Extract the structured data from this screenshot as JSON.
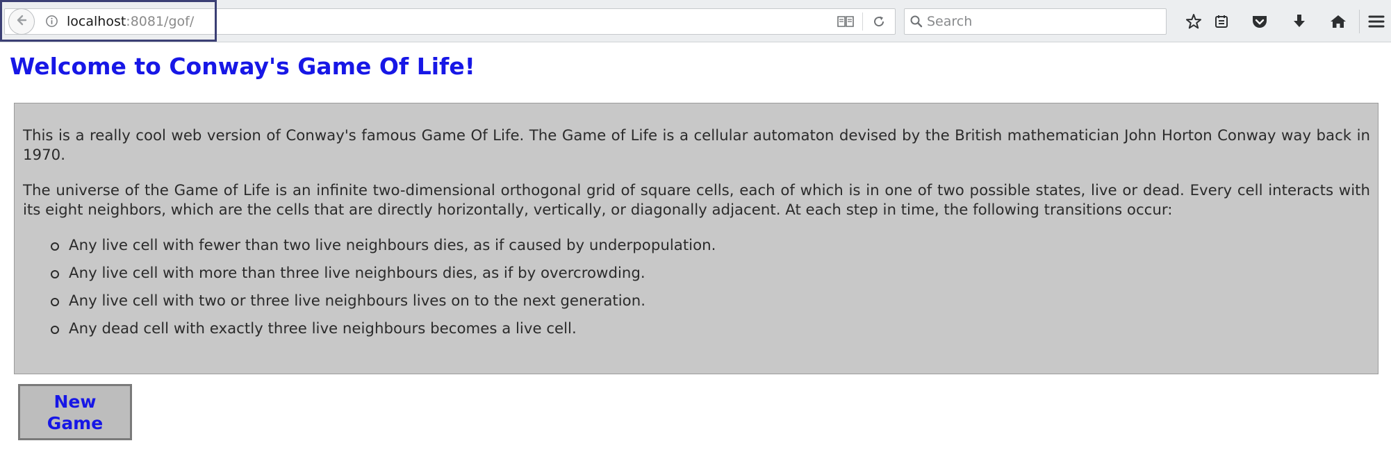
{
  "browser": {
    "url_host": "localhost",
    "url_rest": ":8081/gof/",
    "search_placeholder": "Search",
    "icons": {
      "back": "back-arrow-icon",
      "info": "info-icon",
      "reader": "reader-view-icon",
      "reload": "reload-icon",
      "search": "search-icon",
      "bookmark": "star-icon",
      "library": "library-icon",
      "pocket": "pocket-icon",
      "download": "download-icon",
      "home": "home-icon",
      "menu": "hamburger-menu-icon"
    }
  },
  "page": {
    "title": "Welcome to Conway's Game Of Life!",
    "intro": {
      "paragraph1": "This is a really cool web version of Conway's famous Game Of Life. The Game of Life is a cellular automaton devised by the British mathematician John Horton Conway way back in 1970.",
      "paragraph2": "The universe of the Game of Life is an infinite two-dimensional orthogonal grid of square cells, each of which is in one of two possible states, live or dead. Every cell interacts with its eight neighbors, which are the cells that are directly horizontally, vertically, or diagonally adjacent. At each step in time, the following transitions occur:",
      "rules": [
        "Any live cell with fewer than two live neighbours dies, as if caused by underpopulation.",
        "Any live cell with more than three live neighbours dies, as if by overcrowding.",
        "Any live cell with two or three live neighbours lives on to the next generation.",
        "Any dead cell with exactly three live neighbours becomes a live cell."
      ]
    },
    "new_game_button": "New Game"
  },
  "colors": {
    "title": "#1717e6",
    "panel_background": "#c8c8c8",
    "button_background": "#bdbdbd",
    "button_text": "#1717e6"
  }
}
